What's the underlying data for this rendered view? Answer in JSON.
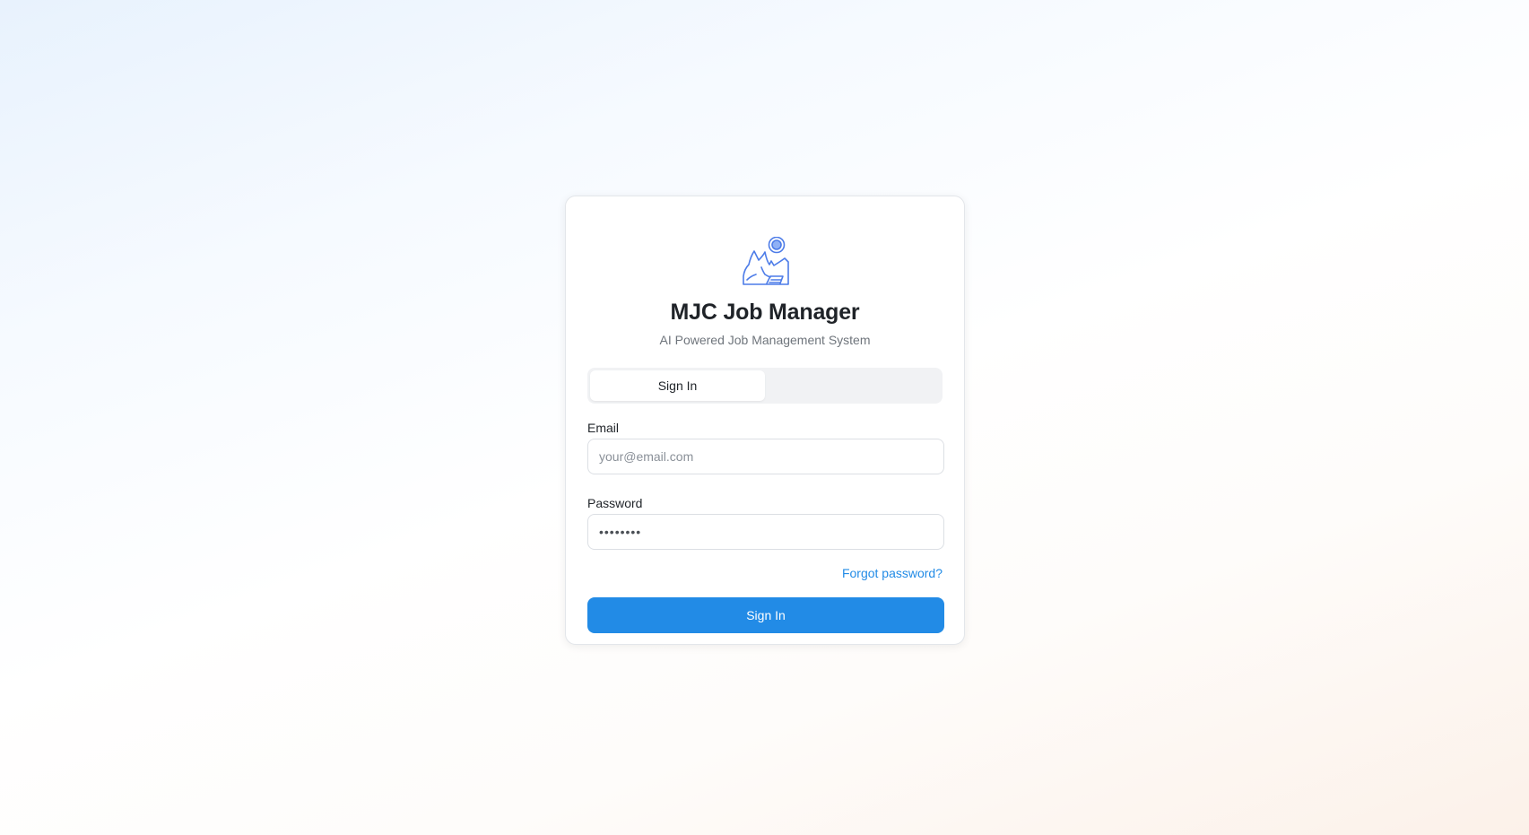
{
  "app": {
    "logo_icon": "mountain-sun-logo-icon",
    "title": "MJC Job Manager",
    "subtitle": "AI Powered Job Management System"
  },
  "tabs": [
    {
      "label": "Sign In",
      "active": true
    },
    {
      "label": "",
      "active": false
    }
  ],
  "form": {
    "email": {
      "label": "Email",
      "value": "",
      "placeholder": "your@email.com"
    },
    "password": {
      "label": "Password",
      "value": "12345678",
      "placeholder": ""
    },
    "forgot_label": "Forgot password?",
    "submit_label": "Sign In"
  },
  "colors": {
    "accent": "#228be6",
    "title_text": "#1f2328",
    "muted_text": "#6f757c",
    "logo_stroke": "#4d7ce8"
  }
}
